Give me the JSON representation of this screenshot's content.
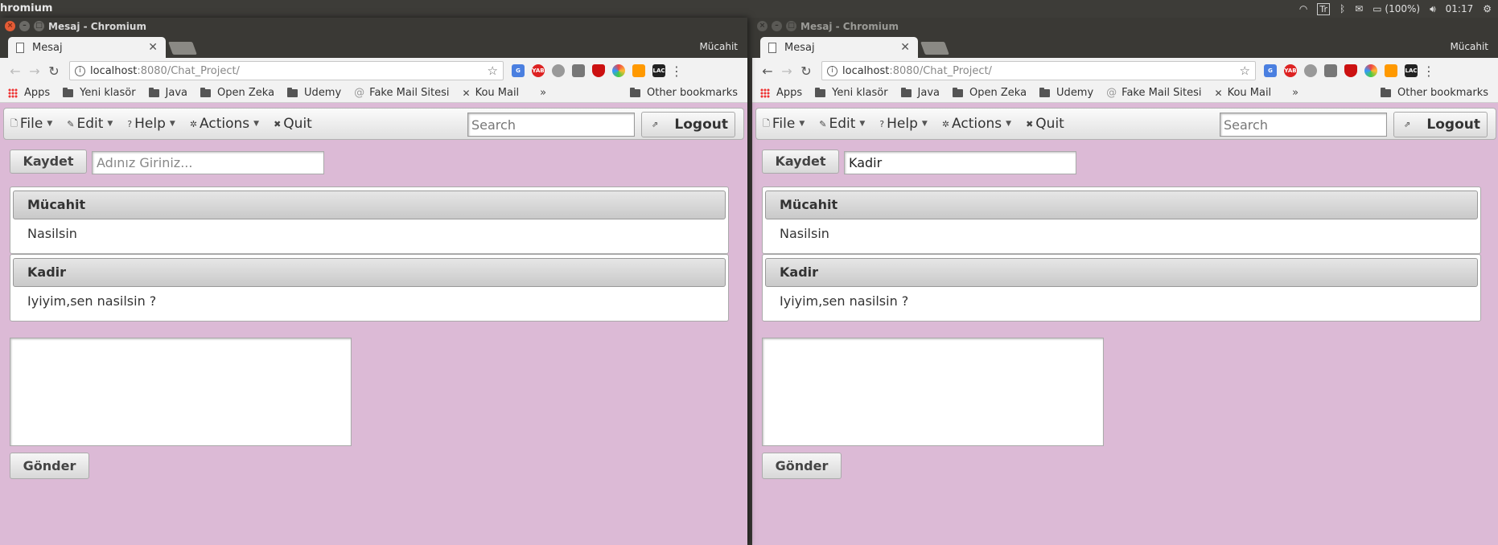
{
  "os_panel": {
    "app_name": "hromium",
    "battery": "(100%)",
    "time": "01:17",
    "lang_badge": "Tr"
  },
  "windows": [
    {
      "title": "Mesaj - Chromium",
      "tab_label": "Mesaj",
      "profile": "Mücahit",
      "url_host": "localhost",
      "url_rest": ":8080/Chat_Project/",
      "bookmarks": [
        "Apps",
        "Yeni klasör",
        "Java",
        "Open Zeka",
        "Udemy",
        "Fake Mail Sitesi",
        "Kou Mail"
      ],
      "other_bookmarks": "Other bookmarks",
      "menu": [
        "File",
        "Edit",
        "Help",
        "Actions",
        "Quit"
      ],
      "search_placeholder": "Search",
      "logout_label": "Logout",
      "save_label": "Kaydet",
      "name_value": "",
      "name_placeholder": "Adınız Giriniz...",
      "messages": [
        {
          "sender": "Mücahit",
          "text": "Nasilsin"
        },
        {
          "sender": "Kadir",
          "text": "Iyiyim,sen nasilsin ?"
        }
      ],
      "send_label": "Gönder"
    },
    {
      "title": "Mesaj - Chromium",
      "tab_label": "Mesaj",
      "profile": "Mücahit",
      "url_host": "localhost",
      "url_rest": ":8080/Chat_Project/",
      "bookmarks": [
        "Apps",
        "Yeni klasör",
        "Java",
        "Open Zeka",
        "Udemy",
        "Fake Mail Sitesi",
        "Kou Mail"
      ],
      "other_bookmarks": "Other bookmarks",
      "menu": [
        "File",
        "Edit",
        "Help",
        "Actions",
        "Quit"
      ],
      "search_placeholder": "Search",
      "logout_label": "Logout",
      "save_label": "Kaydet",
      "name_value": "Kadir",
      "name_placeholder": "Adınız Giriniz...",
      "messages": [
        {
          "sender": "Mücahit",
          "text": "Nasilsin"
        },
        {
          "sender": "Kadir",
          "text": "Iyiyim,sen nasilsin ?"
        }
      ],
      "send_label": "Gönder"
    }
  ],
  "colors": {
    "page_background": "#dcbad6",
    "os_panel": "#3d3c38",
    "close_button": "#e35b35"
  }
}
